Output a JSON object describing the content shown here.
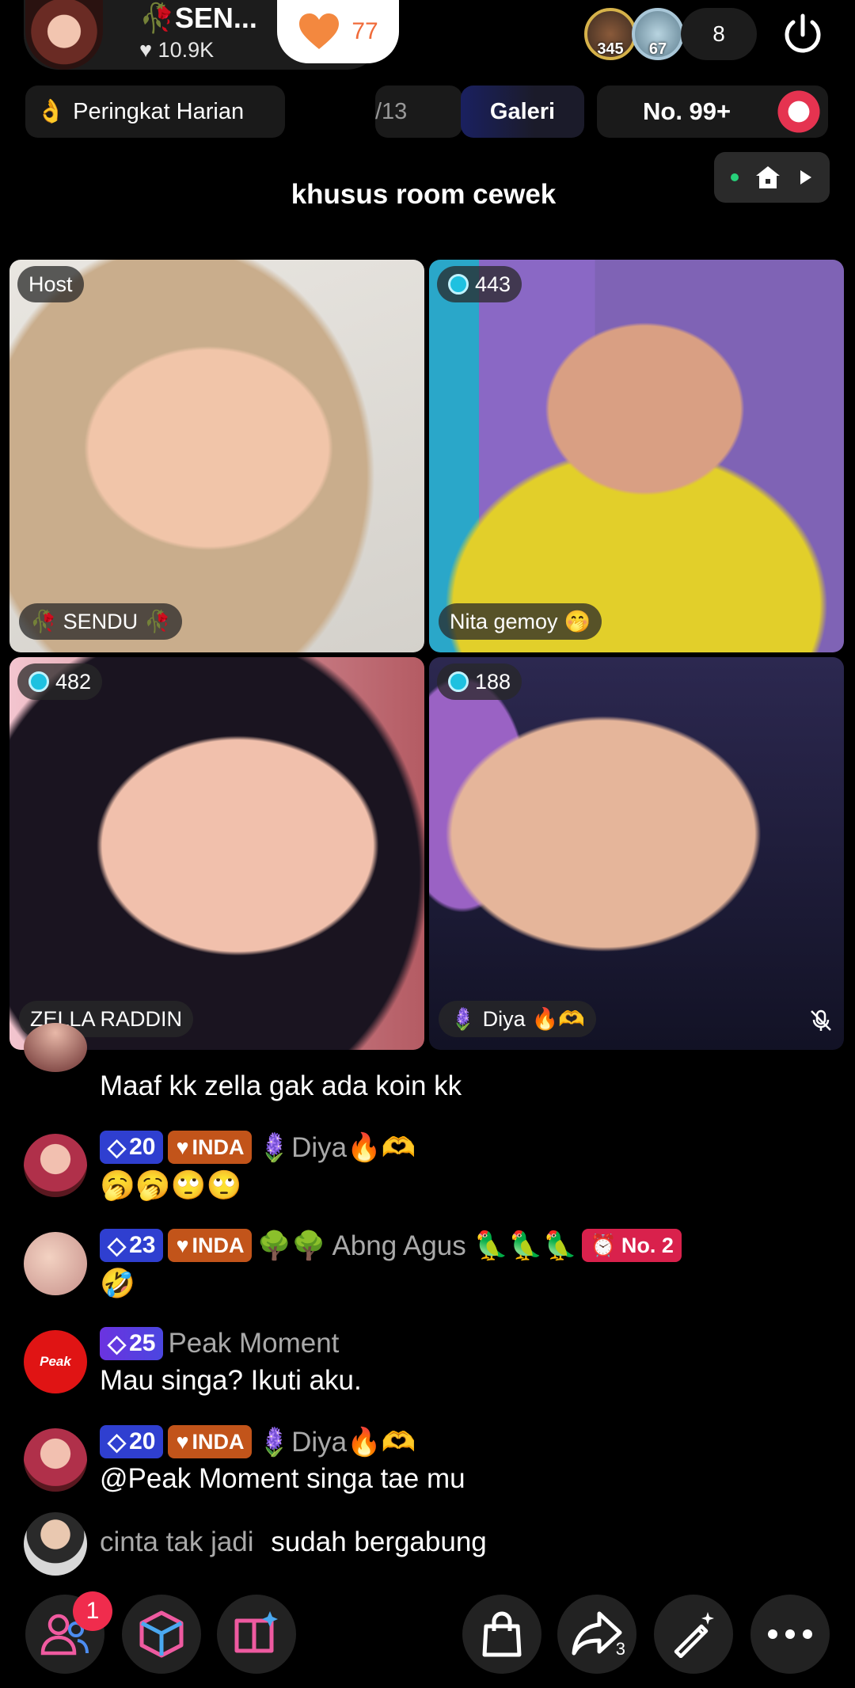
{
  "host": {
    "name": "SEN...",
    "likes": "10.9K",
    "like_count": "77"
  },
  "viewers": {
    "avatars": [
      {
        "value": "345"
      },
      {
        "value": "67"
      }
    ],
    "count": "8"
  },
  "tabs": {
    "rank_label": "Peringkat Harian",
    "partial_label": "/13",
    "galeri_label": "Galeri",
    "number_label": "No. 99+"
  },
  "room_title": "khusus room cewek",
  "tiles": [
    {
      "top_label": "Host",
      "name": "SENDU"
    },
    {
      "top_label": "443",
      "name": "Nita gemoy"
    },
    {
      "top_label": "482",
      "name": "ZELLA RADDIN"
    },
    {
      "top_label": "188",
      "name": "Diya"
    }
  ],
  "chat": {
    "partial_message": "Maaf kk zella gak ada koin kk",
    "messages": [
      {
        "level": "20",
        "fan": "INDA",
        "user": "Diya",
        "text": "🥱🥱🙄🙄"
      },
      {
        "level": "23",
        "fan": "INDA",
        "user": "Abng Agus",
        "rank": "No. 2",
        "text": "🤣"
      },
      {
        "level": "25",
        "user": "Peak Moment",
        "text": "Mau singa? Ikuti aku."
      },
      {
        "level": "20",
        "fan": "INDA",
        "user": "Diya",
        "text": "@Peak Moment singa tae mu"
      }
    ],
    "join": {
      "user": "cinta tak jadi",
      "text": "sudah bergabung"
    }
  },
  "bottom_bar": {
    "notification_count": "1",
    "share_count": "3"
  },
  "colors": {
    "like": "#f06b3a",
    "level_badge": "#2f3fd0",
    "fan_badge": "#c2541a",
    "rank_badge": "#d9214c",
    "notif": "#f02c4d",
    "mic_dot": "#27d07a"
  }
}
